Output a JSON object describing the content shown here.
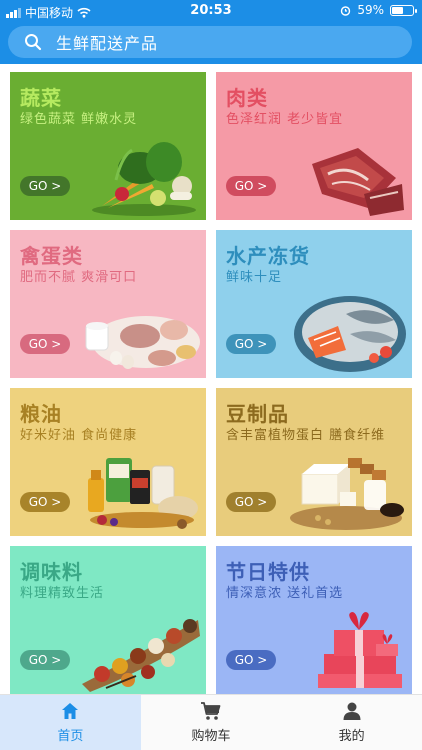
{
  "status": {
    "carrier": "中国移动",
    "time": "20:53",
    "battery": "59%",
    "battery_level": 0.59
  },
  "search": {
    "label": "生鲜配送产品"
  },
  "colors": {
    "accent": "#1c8ee6"
  },
  "categories": [
    {
      "title": "蔬菜",
      "subtitle": "绿色蔬菜 鲜嫩水灵",
      "go": "GO >",
      "bg": "#6aae32",
      "title_color": "#b6ea60",
      "sub_color": "#c6f080",
      "go_bg": "#43762a"
    },
    {
      "title": "肉类",
      "subtitle": "色泽红润 老少皆宜",
      "go": "GO >",
      "bg": "#f59aa6",
      "title_color": "#e34f62",
      "sub_color": "#e34f62",
      "go_bg": "#d04c5f"
    },
    {
      "title": "禽蛋类",
      "subtitle": "肥而不腻 爽滑可口",
      "go": "GO >",
      "bg": "#f7b7c2",
      "title_color": "#e06a80",
      "sub_color": "#e06a80",
      "go_bg": "#d86a7f"
    },
    {
      "title": "水产冻货",
      "subtitle": "鲜味十足",
      "go": "GO >",
      "bg": "#8fd0ec",
      "title_color": "#2e8ebd",
      "sub_color": "#2e8ebd",
      "go_bg": "#3e93ba"
    },
    {
      "title": "粮油",
      "subtitle": "好米好油 食尚健康",
      "go": "GO >",
      "bg": "#eed27e",
      "title_color": "#a88124",
      "sub_color": "#a88124",
      "go_bg": "#a8842a"
    },
    {
      "title": "豆制品",
      "subtitle": "含丰富植物蛋白 膳食纤维",
      "go": "GO >",
      "bg": "#e8cc7c",
      "title_color": "#8c6a1e",
      "sub_color": "#8c6a1e",
      "go_bg": "#a0802e"
    },
    {
      "title": "调味料",
      "subtitle": "料理精致生活",
      "go": "GO >",
      "bg": "#7fe8c4",
      "title_color": "#3aa886",
      "sub_color": "#3aa886",
      "go_bg": "#4ea88c"
    },
    {
      "title": "节日特供",
      "subtitle": "情深意浓 送礼首选",
      "go": "GO >",
      "bg": "#9bb6f5",
      "title_color": "#3d5fb6",
      "sub_color": "#3d5fb6",
      "go_bg": "#4a6cc2"
    }
  ],
  "tabs": [
    {
      "label": "首页",
      "icon": "home-icon",
      "active": true
    },
    {
      "label": "购物车",
      "icon": "cart-icon",
      "active": false
    },
    {
      "label": "我的",
      "icon": "user-icon",
      "active": false
    }
  ]
}
